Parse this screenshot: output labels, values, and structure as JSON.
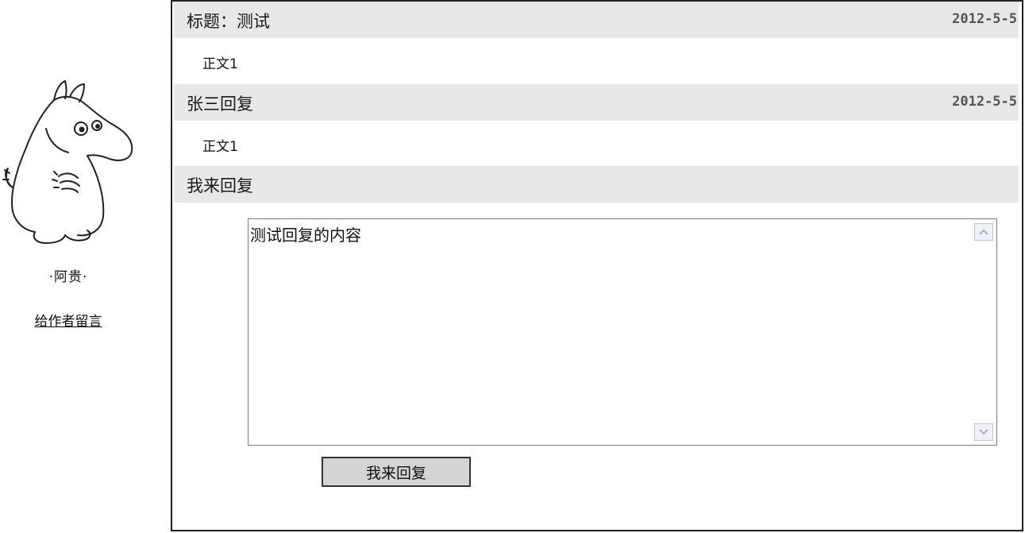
{
  "author": {
    "name": "·阿贵·",
    "message_link": "给作者留言",
    "avatar_icon": "moomin-avatar-icon"
  },
  "post": {
    "title": "标题：测试",
    "date": "2012-5-5",
    "body": "正文1"
  },
  "replies": [
    {
      "title": "张三回复",
      "date": "2012-5-5",
      "body": "正文1"
    }
  ],
  "reply_form": {
    "heading": "我来回复",
    "textarea_value": "测试回复的内容",
    "submit_label": "我来回复",
    "scroll_up_icon": "chevron-up-icon",
    "scroll_down_icon": "chevron-down-icon"
  },
  "colors": {
    "bar_background": "#e8e8e8",
    "date_text": "#555555",
    "border": "#222222",
    "button_background": "#d4d4d4"
  }
}
